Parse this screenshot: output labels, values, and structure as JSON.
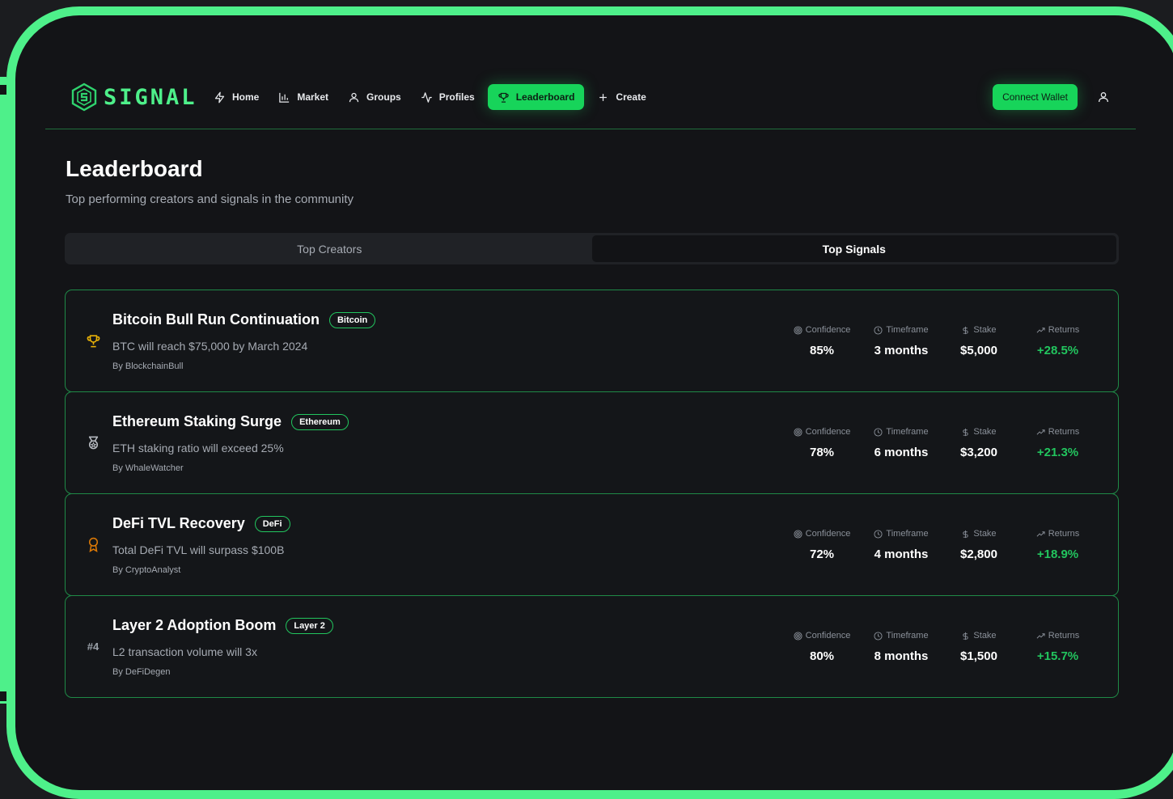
{
  "brand": {
    "name": "SIGNAL",
    "accent": "#22c55e"
  },
  "nav": {
    "items": [
      {
        "label": "Home",
        "icon": "bolt-icon"
      },
      {
        "label": "Market",
        "icon": "bar-chart-icon"
      },
      {
        "label": "Groups",
        "icon": "user-icon"
      },
      {
        "label": "Profiles",
        "icon": "activity-icon"
      },
      {
        "label": "Leaderboard",
        "icon": "trophy-icon",
        "active": true
      },
      {
        "label": "Create",
        "icon": "plus-icon"
      }
    ],
    "connect_label": "Connect Wallet",
    "profile_icon": "user-icon"
  },
  "page": {
    "title": "Leaderboard",
    "subtitle": "Top performing creators and signals in the community"
  },
  "tabs": [
    {
      "label": "Top Creators",
      "active": false
    },
    {
      "label": "Top Signals",
      "active": true
    }
  ],
  "stat_labels": {
    "confidence": "Confidence",
    "timeframe": "Timeframe",
    "stake": "Stake",
    "returns": "Returns"
  },
  "signals": [
    {
      "rank_icon": "trophy-icon",
      "rank_color": "#eab308",
      "title": "Bitcoin Bull Run Continuation",
      "tag": "Bitcoin",
      "description": "BTC will reach $75,000 by March 2024",
      "author": "By BlockchainBull",
      "confidence": "85%",
      "timeframe": "3 months",
      "stake": "$5,000",
      "returns": "+28.5%"
    },
    {
      "rank_icon": "medal-icon",
      "rank_color": "#b8bcc2",
      "title": "Ethereum Staking Surge",
      "tag": "Ethereum",
      "description": "ETH staking ratio will exceed 25%",
      "author": "By WhaleWatcher",
      "confidence": "78%",
      "timeframe": "6 months",
      "stake": "$3,200",
      "returns": "+21.3%"
    },
    {
      "rank_icon": "award-icon",
      "rank_color": "#d97706",
      "title": "DeFi TVL Recovery",
      "tag": "DeFi",
      "description": "Total DeFi TVL will surpass $100B",
      "author": "By CryptoAnalyst",
      "confidence": "72%",
      "timeframe": "4 months",
      "stake": "$2,800",
      "returns": "+18.9%"
    },
    {
      "rank_text": "#4",
      "title": "Layer 2 Adoption Boom",
      "tag": "Layer 2",
      "description": "L2 transaction volume will 3x",
      "author": "By DeFiDegen",
      "confidence": "80%",
      "timeframe": "8 months",
      "stake": "$1,500",
      "returns": "+15.7%"
    }
  ]
}
